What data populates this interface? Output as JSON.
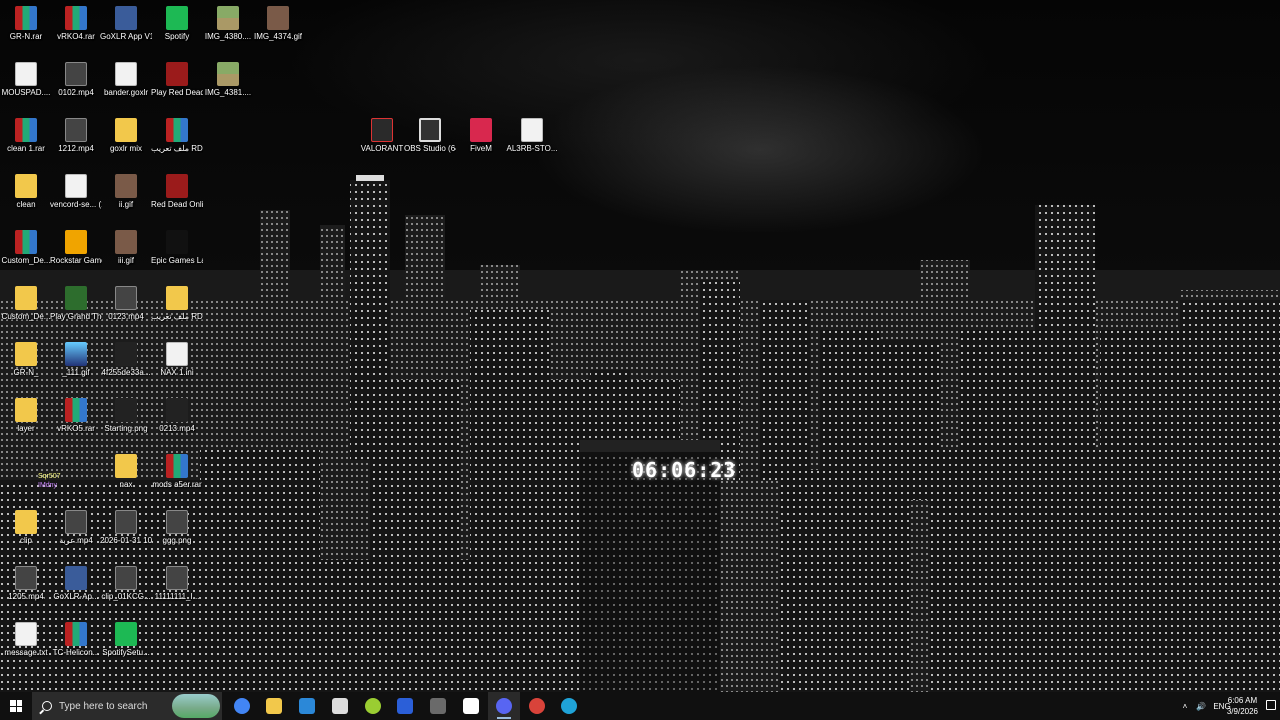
{
  "desktop": {
    "icons": [
      {
        "label": "GR-N.rar",
        "type": "rar"
      },
      {
        "label": "vRKO4.rar",
        "type": "rar"
      },
      {
        "label": "GoXLR App V1.5.11.228...",
        "type": "app"
      },
      {
        "label": "Spotify",
        "type": "spotify"
      },
      {
        "label": "IMG_4380....",
        "type": "image"
      },
      {
        "label": "IMG_4374.gif",
        "type": "gif"
      },
      {
        "label": "MOUSPAD....",
        "type": "file"
      },
      {
        "label": "0102.mp4",
        "type": "video"
      },
      {
        "label": "bander.goxlr",
        "type": "file"
      },
      {
        "label": "Play Red Dead Rede...",
        "type": "rdr"
      },
      {
        "label": "IMG_4381....",
        "type": "image"
      },
      {
        "label": "clean 1.rar",
        "type": "rar"
      },
      {
        "label": "1212.mp4",
        "type": "video"
      },
      {
        "label": "goxlr mix",
        "type": "folder"
      },
      {
        "label": "ملف تعريب RDR...",
        "type": "rar"
      },
      {
        "label": "clean",
        "type": "folder"
      },
      {
        "label": "vencord-se... (1) (1).json",
        "type": "file"
      },
      {
        "label": "ii.gif",
        "type": "gif"
      },
      {
        "label": "Red Dead Online",
        "type": "rdr"
      },
      {
        "label": "Custom_De...",
        "type": "rar"
      },
      {
        "label": "Rockstar Games ...",
        "type": "rockstar"
      },
      {
        "label": "iii.gif",
        "type": "gif"
      },
      {
        "label": "Epic Games Launcher",
        "type": "epic"
      },
      {
        "label": "Custom_De...",
        "type": "folder"
      },
      {
        "label": "Play Grand Theft Auto...",
        "type": "gta"
      },
      {
        "label": "0123.mp4",
        "type": "video"
      },
      {
        "label": "ملف تعريب RDR2",
        "type": "folder"
      },
      {
        "label": "GR-N_",
        "type": "folder"
      },
      {
        "label": "_111.gif",
        "type": "blue"
      },
      {
        "label": "4f255de33a...",
        "type": "dark"
      },
      {
        "label": "NAX 1.ini",
        "type": "file"
      },
      {
        "label": "layer",
        "type": "folder"
      },
      {
        "label": "vRKO5.rar",
        "type": "rar"
      },
      {
        "label": "Starting.png",
        "type": "dark"
      },
      {
        "label": "0213.mp4",
        "type": "dark"
      },
      {
        "label": "nax",
        "type": "folder"
      },
      {
        "label": "mods a5er.rar",
        "type": "rar"
      },
      {
        "label": "clip",
        "type": "folder"
      },
      {
        "label": "عربة.mp4",
        "type": "video"
      },
      {
        "label": "2026-01-31 10-48-19_...",
        "type": "video"
      },
      {
        "label": "ggg.png",
        "type": "video"
      },
      {
        "label": "1205.mp4",
        "type": "video"
      },
      {
        "label": "GoXLR-Ap...",
        "type": "app"
      },
      {
        "label": "clip_01KCG...",
        "type": "video"
      },
      {
        "label": "11111111_I...",
        "type": "video"
      },
      {
        "label": "message.txt",
        "type": "file"
      },
      {
        "label": "TC-Helicon...",
        "type": "rar"
      },
      {
        "label": "SpotifySetu...",
        "type": "spotify"
      },
      {
        "label": "VALORANT",
        "type": "valorant"
      },
      {
        "label": "OBS Studio (64bit)",
        "type": "obs"
      },
      {
        "label": "FiveM",
        "type": "fivem"
      },
      {
        "label": "AL3RB-STO...",
        "type": "file"
      }
    ],
    "overlay_text": {
      "line1": "Sqr507",
      "line2": "IMdny"
    },
    "wallpaper_clock": "06:06:23"
  },
  "taskbar": {
    "search_placeholder": "Type here to search",
    "apps": [
      {
        "name": "chrome-icon",
        "color": "#4285f4"
      },
      {
        "name": "file-explorer-icon",
        "color": "#f2c84b"
      },
      {
        "name": "microsoft-store-icon",
        "color": "#2b88d8"
      },
      {
        "name": "mail-icon",
        "color": "#dddddd"
      },
      {
        "name": "green-app-icon",
        "color": "#9acd32"
      },
      {
        "name": "blue-app-icon",
        "color": "#2b5fd8"
      },
      {
        "name": "xbox-icon",
        "color": "#6a6a6a"
      },
      {
        "name": "fivem-taskbar-icon",
        "color": "#ffffff"
      },
      {
        "name": "discord-icon",
        "color": "#5865f2"
      },
      {
        "name": "obs-taskbar-icon",
        "color": "#d9433a"
      },
      {
        "name": "edge-icon",
        "color": "#1fa3d8"
      }
    ],
    "tray": {
      "language": "ENG"
    },
    "clock": {
      "time": "6:06 AM",
      "date": "3/9/2026"
    }
  }
}
